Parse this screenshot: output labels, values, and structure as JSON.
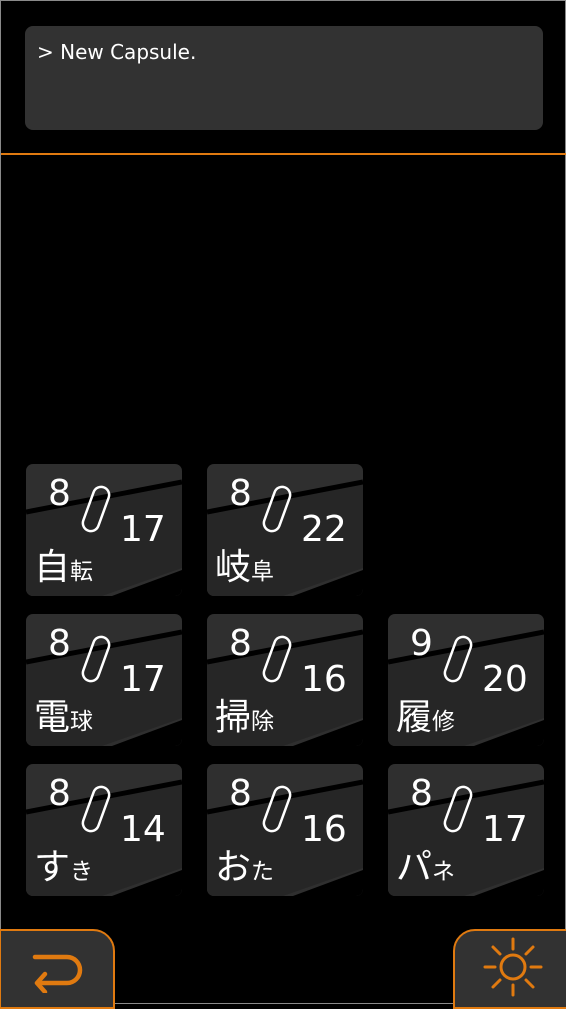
{
  "console": {
    "text": "> New Capsule."
  },
  "capsules": [
    {
      "month": "8",
      "day": "17",
      "title_big": "自",
      "title_small": "転"
    },
    {
      "month": "8",
      "day": "22",
      "title_big": "岐",
      "title_small": "阜"
    },
    {
      "month": "8",
      "day": "17",
      "title_big": "電",
      "title_small": "球"
    },
    {
      "month": "8",
      "day": "16",
      "title_big": "掃",
      "title_small": "除"
    },
    {
      "month": "9",
      "day": "20",
      "title_big": "履",
      "title_small": "修"
    },
    {
      "month": "8",
      "day": "14",
      "title_big": "す",
      "title_small": "き"
    },
    {
      "month": "8",
      "day": "16",
      "title_big": "お",
      "title_small": "た"
    },
    {
      "month": "8",
      "day": "17",
      "title_big": "パ",
      "title_small": "ネ"
    }
  ],
  "buttons": {
    "back_icon": "return-arrow-icon",
    "settings_icon": "sun-icon"
  },
  "colors": {
    "accent": "#e07a10",
    "panel": "#323232",
    "tile": "#2f2f2f",
    "background": "#000000"
  }
}
